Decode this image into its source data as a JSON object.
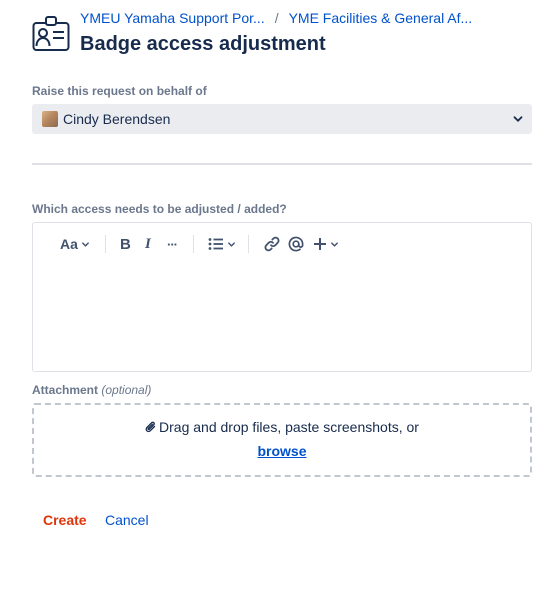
{
  "header": {
    "breadcrumb": [
      "YMEU Yamaha Support Por...",
      "YME Facilities & General Af..."
    ],
    "separator": "/",
    "title": "Badge access adjustment",
    "icon": "id-badge-icon"
  },
  "on_behalf": {
    "label": "Raise this request on behalf of",
    "selected": "Cindy Berendsen"
  },
  "access_field": {
    "label": "Which access needs to be adjusted / added?",
    "value": "",
    "toolbar": {
      "text_style": "Aa",
      "bold": "B",
      "italic": "I",
      "more": "···"
    }
  },
  "attachment": {
    "label": "Attachment",
    "optional": "(optional)",
    "dropzone_text": "Drag and drop files, paste screenshots, or",
    "browse": "browse"
  },
  "actions": {
    "create": "Create",
    "cancel": "Cancel"
  },
  "colors": {
    "link": "#0052cc",
    "create": "#de350b",
    "label": "#6b778c",
    "select_bg": "#ebecf0"
  }
}
